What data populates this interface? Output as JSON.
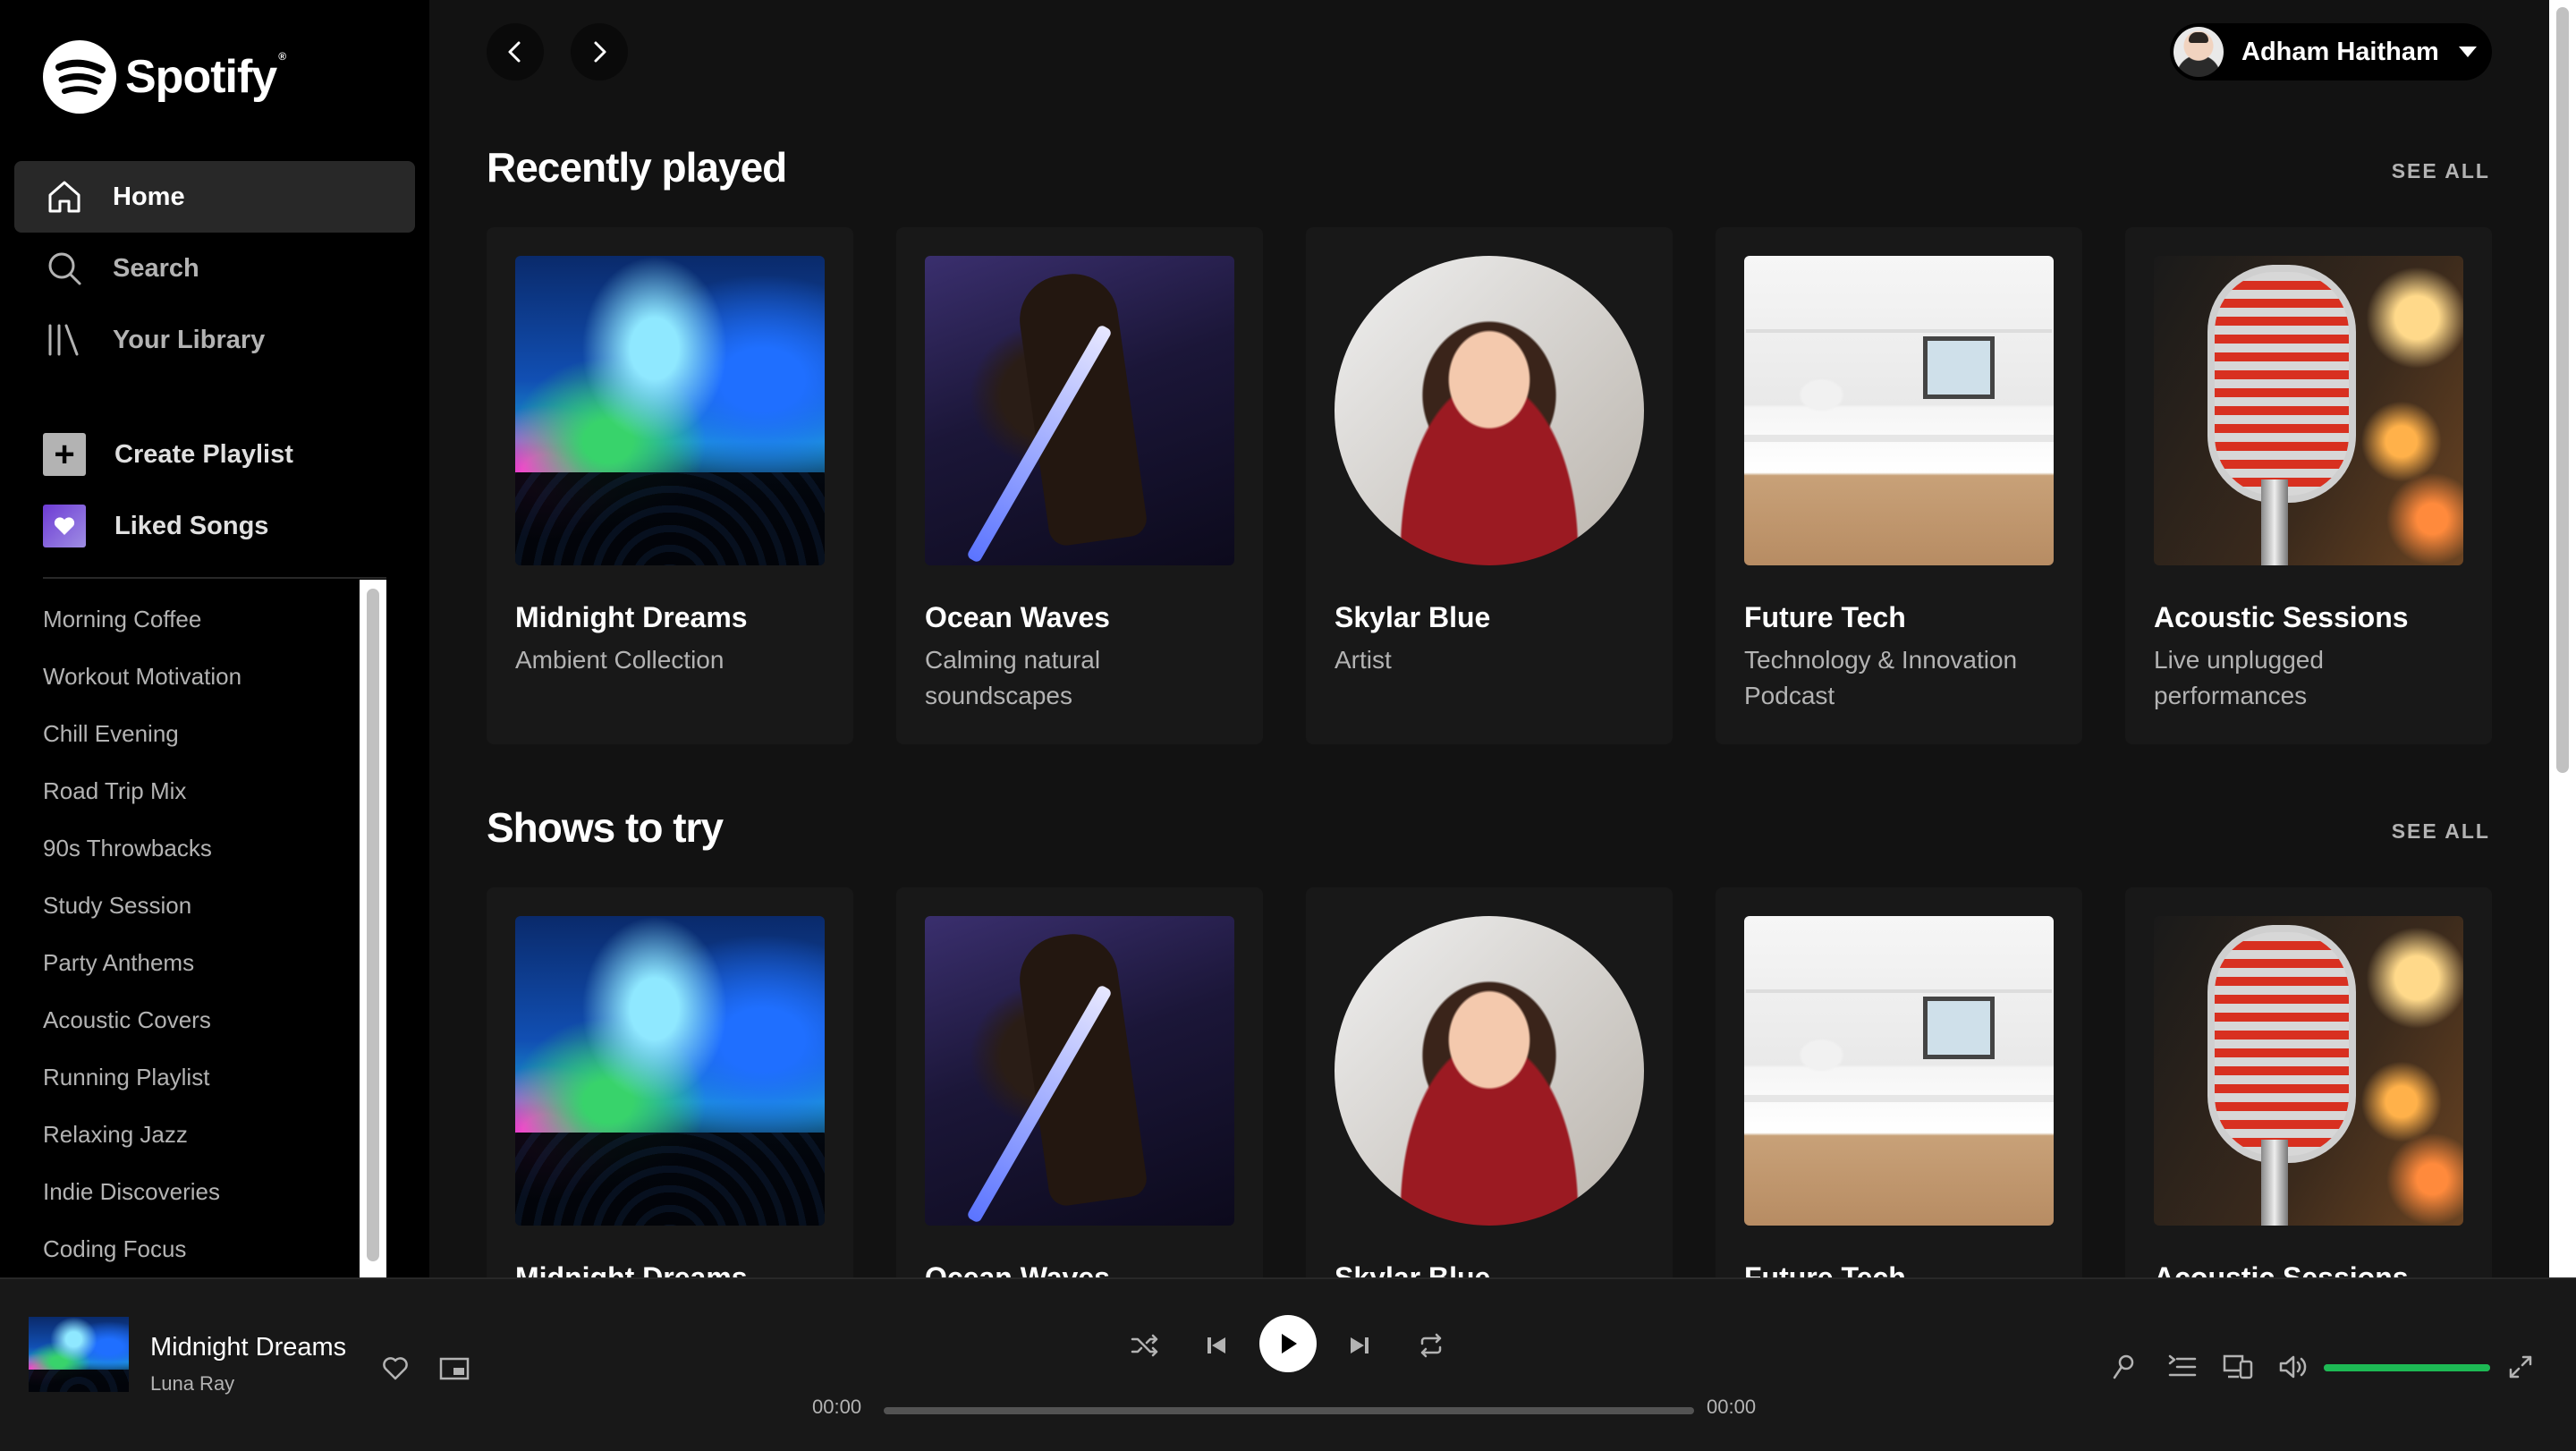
{
  "app": {
    "name": "Spotify"
  },
  "colors": {
    "accent": "#1db954",
    "background": "#121212",
    "sidebar": "#000000",
    "card": "#181818",
    "muted_text": "#b3b3b3"
  },
  "sidebar": {
    "nav": [
      {
        "label": "Home",
        "icon": "home-icon",
        "active": true
      },
      {
        "label": "Search",
        "icon": "search-icon",
        "active": false
      },
      {
        "label": "Your Library",
        "icon": "library-icon",
        "active": false
      }
    ],
    "actions": [
      {
        "label": "Create Playlist",
        "icon": "plus-icon"
      },
      {
        "label": "Liked Songs",
        "icon": "heart-icon"
      }
    ],
    "playlists": [
      "Morning Coffee",
      "Workout Motivation",
      "Chill Evening",
      "Road Trip Mix",
      "90s Throwbacks",
      "Study Session",
      "Party Anthems",
      "Acoustic Covers",
      "Running Playlist",
      "Relaxing Jazz",
      "Indie Discoveries",
      "Coding Focus"
    ]
  },
  "header": {
    "user_name": "Adham Haitham"
  },
  "sections": [
    {
      "title": "Recently played",
      "see_all": "SEE ALL",
      "cards": [
        {
          "title": "Midnight Dreams",
          "subtitle": "Ambient Collection",
          "art": "concert"
        },
        {
          "title": "Ocean Waves",
          "subtitle": "Calming natural soundscapes",
          "art": "guitar"
        },
        {
          "title": "Skylar Blue",
          "subtitle": "Artist",
          "art": "woman"
        },
        {
          "title": "Future Tech",
          "subtitle": "Technology & Innovation Podcast",
          "art": "office"
        },
        {
          "title": "Acoustic Sessions",
          "subtitle": "Live unplugged performances",
          "art": "mic"
        }
      ]
    },
    {
      "title": "Shows to try",
      "see_all": "SEE ALL",
      "cards": [
        {
          "title": "Midnight Dreams",
          "art": "concert"
        },
        {
          "title": "Ocean Waves",
          "art": "guitar"
        },
        {
          "title": "Skylar Blue",
          "art": "woman"
        },
        {
          "title": "Future Tech",
          "art": "office"
        },
        {
          "title": "Acoustic Sessions",
          "art": "mic"
        }
      ]
    }
  ],
  "player": {
    "track_title": "Midnight Dreams",
    "artist": "Luna Ray",
    "elapsed": "00:00",
    "duration": "00:00",
    "progress_fraction": 0,
    "volume_fraction": 1.0
  }
}
